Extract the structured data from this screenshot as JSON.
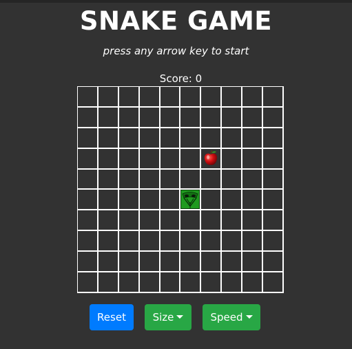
{
  "game": {
    "title": "SNAKE GAME",
    "instruction": "press any arrow key to start",
    "score_label": "Score: 0",
    "score": 0
  },
  "board": {
    "rows": 10,
    "cols": 10,
    "line_color": "#ffffff",
    "snake": [
      {
        "row": 5,
        "col": 5
      }
    ],
    "apple": {
      "row": 3,
      "col": 6
    }
  },
  "controls": {
    "reset_label": "Reset",
    "size_label": "Size",
    "speed_label": "Speed"
  },
  "colors": {
    "background": "#323232",
    "reset_button": "#007bff",
    "dropdown_button": "#28a745",
    "snake": "#1f9a1f",
    "apple": "#d10f12"
  },
  "icons": {
    "snake_head": "snake-head-icon",
    "apple": "apple-icon",
    "caret": "caret-down-icon"
  }
}
